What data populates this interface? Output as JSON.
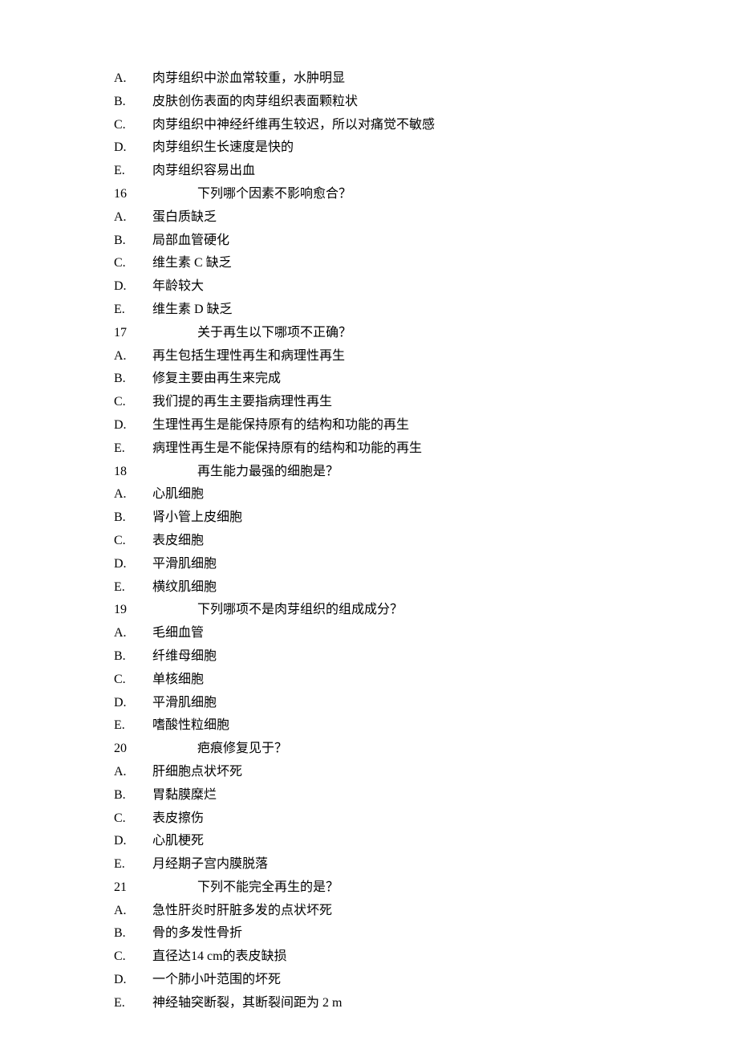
{
  "lines": [
    {
      "type": "option",
      "label": "A.",
      "text": "肉芽组织中淤血常较重，水肿明显"
    },
    {
      "type": "option",
      "label": "B.",
      "text": "皮肤创伤表面的肉芽组织表面颗粒状"
    },
    {
      "type": "option",
      "label": "C.",
      "text": "肉芽组织中神经纤维再生较迟，所以对痛觉不敏感"
    },
    {
      "type": "option",
      "label": "D.",
      "text": "肉芽组织生长速度是快的"
    },
    {
      "type": "option",
      "label": "E.",
      "text": "肉芽组织容易出血"
    },
    {
      "type": "question",
      "num": "16",
      "text": "下列哪个因素不影响愈合？"
    },
    {
      "type": "option",
      "label": "A.",
      "text": "蛋白质缺乏"
    },
    {
      "type": "option",
      "label": "B.",
      "text": "局部血管硬化"
    },
    {
      "type": "option",
      "label": "C.",
      "text": "维生素 C 缺乏"
    },
    {
      "type": "option",
      "label": "D.",
      "text": "年龄较大"
    },
    {
      "type": "option",
      "label": "E.",
      "text": "维生素 D 缺乏"
    },
    {
      "type": "question",
      "num": "17",
      "text": "关于再生以下哪项不正确？"
    },
    {
      "type": "option",
      "label": "A.",
      "text": "再生包括生理性再生和病理性再生"
    },
    {
      "type": "option",
      "label": "B.",
      "text": "修复主要由再生来完成"
    },
    {
      "type": "option",
      "label": "C.",
      "text": "我们提的再生主要指病理性再生"
    },
    {
      "type": "option",
      "label": "D.",
      "text": "生理性再生是能保持原有的结构和功能的再生"
    },
    {
      "type": "option",
      "label": "E.",
      "text": "病理性再生是不能保持原有的结构和功能的再生"
    },
    {
      "type": "question",
      "num": "18",
      "text": "再生能力最强的细胞是？"
    },
    {
      "type": "option",
      "label": "A.",
      "text": "心肌细胞"
    },
    {
      "type": "option",
      "label": "B.",
      "text": "肾小管上皮细胞"
    },
    {
      "type": "option",
      "label": "C.",
      "text": "表皮细胞"
    },
    {
      "type": "option",
      "label": "D.",
      "text": "平滑肌细胞"
    },
    {
      "type": "option",
      "label": "E.",
      "text": "横纹肌细胞"
    },
    {
      "type": "question",
      "num": "19",
      "text": "下列哪项不是肉芽组织的组成成分？"
    },
    {
      "type": "option",
      "label": "A.",
      "text": "毛细血管"
    },
    {
      "type": "option",
      "label": "B.",
      "text": "纤维母细胞"
    },
    {
      "type": "option",
      "label": "C.",
      "text": "单核细胞"
    },
    {
      "type": "option",
      "label": "D.",
      "text": "平滑肌细胞"
    },
    {
      "type": "option",
      "label": "E.",
      "text": "嗜酸性粒细胞"
    },
    {
      "type": "question",
      "num": "20",
      "text": "疤痕修复见于？"
    },
    {
      "type": "option",
      "label": "A.",
      "text": "肝细胞点状坏死"
    },
    {
      "type": "option",
      "label": "B.",
      "text": "胃黏膜糜烂"
    },
    {
      "type": "option",
      "label": "C.",
      "text": "表皮擦伤"
    },
    {
      "type": "option",
      "label": "D.",
      "text": "心肌梗死"
    },
    {
      "type": "option",
      "label": "E.",
      "text": "月经期子宫内膜脱落"
    },
    {
      "type": "question",
      "num": "21",
      "text": "下列不能完全再生的是？"
    },
    {
      "type": "option",
      "label": "A.",
      "text": "急性肝炎时肝脏多发的点状坏死"
    },
    {
      "type": "option",
      "label": "B.",
      "text": "骨的多发性骨折"
    },
    {
      "type": "option",
      "label": "C.",
      "text": "直径达14 cm的表皮缺损"
    },
    {
      "type": "option",
      "label": "D.",
      "text": "一个肺小叶范围的坏死"
    },
    {
      "type": "option",
      "label": "E.",
      "text": "神经轴突断裂，其断裂间距为 2 m"
    }
  ]
}
